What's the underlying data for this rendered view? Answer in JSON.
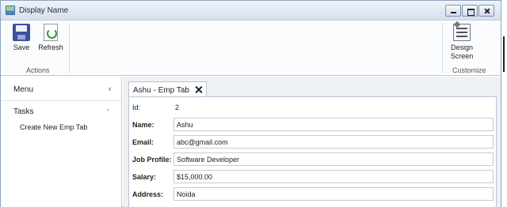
{
  "window": {
    "title": "Display Name"
  },
  "ribbon": {
    "save_label": "Save",
    "refresh_label": "Refresh",
    "actions_group": "Actions",
    "design_line1": "Design",
    "design_line2": "Screen",
    "customize_group": "Customize"
  },
  "sidebar": {
    "menu_title": "Menu",
    "tasks_title": "Tasks",
    "items": [
      {
        "label": "Create New Emp Tab"
      }
    ]
  },
  "tab": {
    "label": "Ashu - Emp Tab"
  },
  "form": {
    "id_label": "Id:",
    "id_value": "2",
    "fields": [
      {
        "label": "Name:",
        "value": "Ashu"
      },
      {
        "label": "Email:",
        "value": "abc@gmail.com"
      },
      {
        "label": "Job Profile:",
        "value": "Software Developer"
      },
      {
        "label": "Salary:",
        "value": "$15,000.00"
      },
      {
        "label": "Address:",
        "value": "Noida"
      }
    ]
  },
  "icons": {
    "title": "app-icon",
    "save": "save-icon",
    "refresh": "refresh-icon",
    "design": "design-screen-icon",
    "collapse_menu": "chevron-left-icon",
    "collapse_tasks": "chevron-up-icon",
    "close_tab": "close-icon"
  }
}
